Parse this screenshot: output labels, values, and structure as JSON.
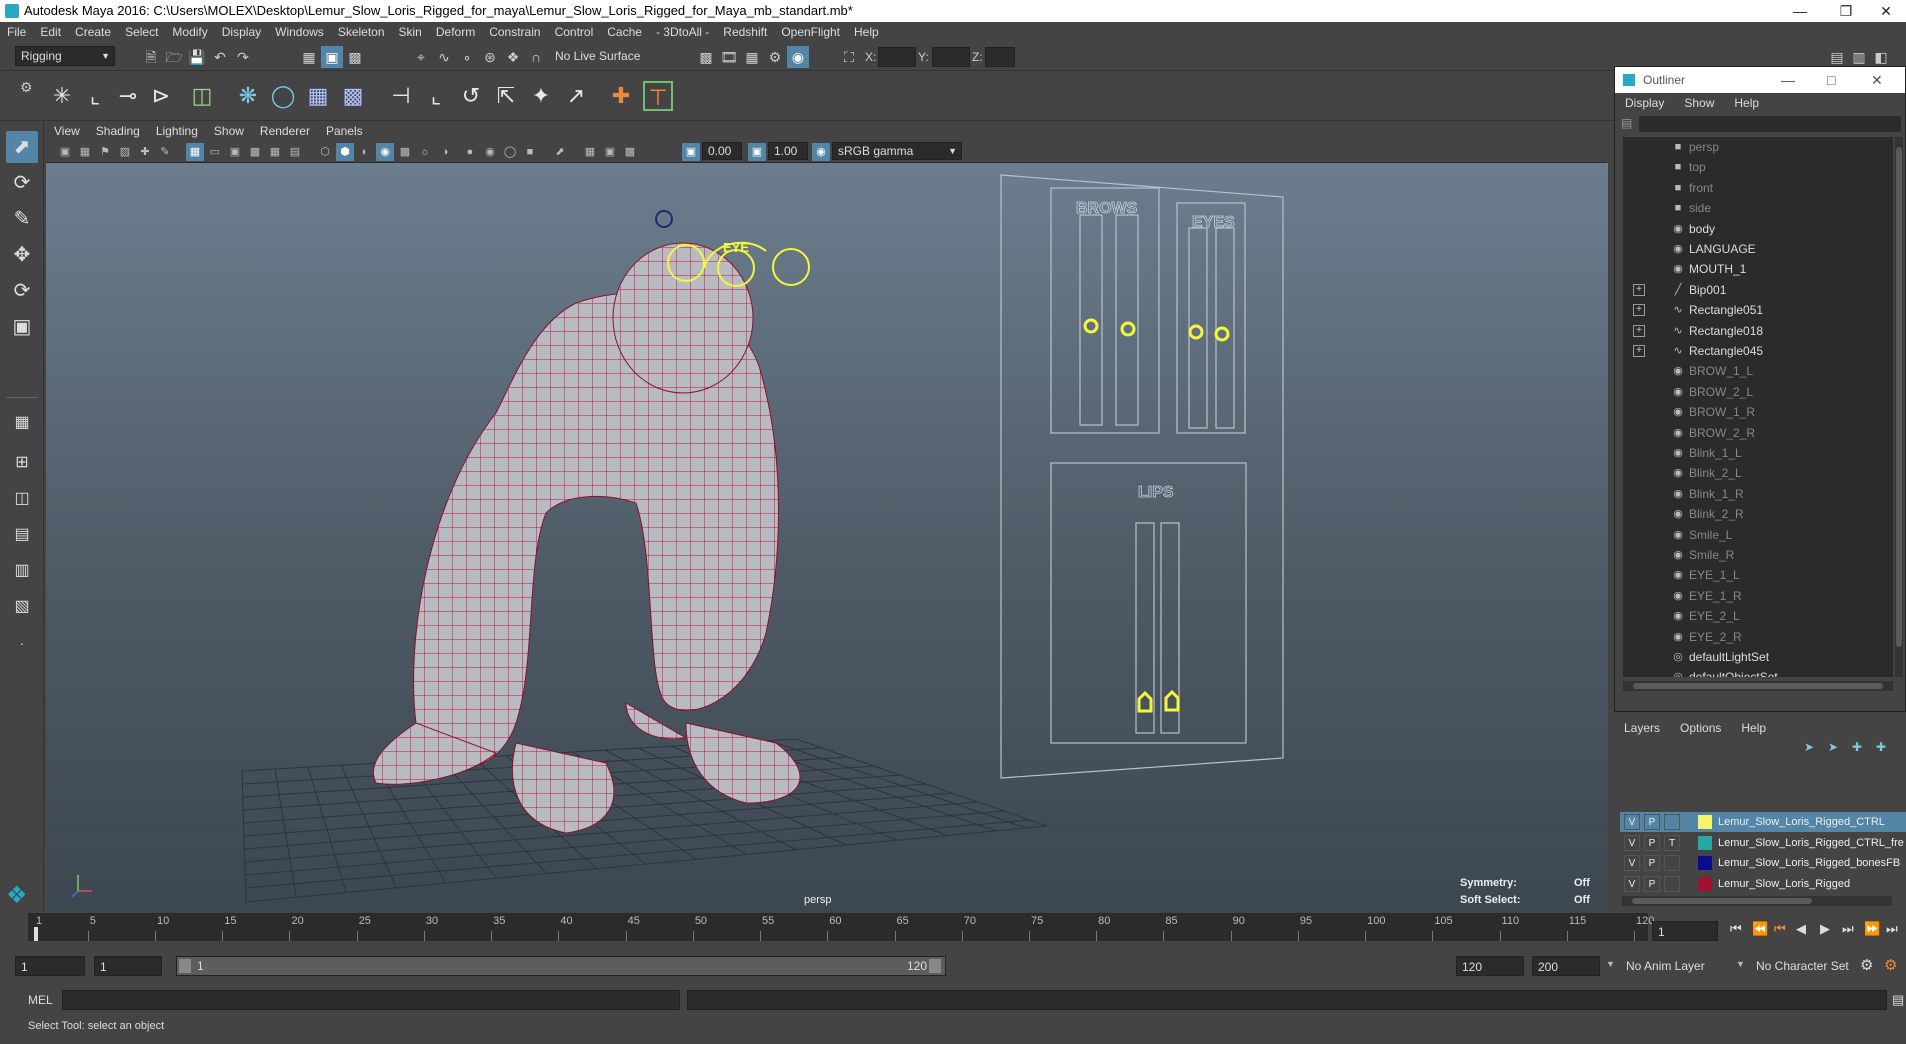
{
  "window": {
    "title": "Autodesk Maya 2016: C:\\Users\\MOLEX\\Desktop\\Lemur_Slow_Loris_Rigged_for_maya\\Lemur_Slow_Loris_Rigged_for_Maya_mb_standart.mb*"
  },
  "menubar": [
    "File",
    "Edit",
    "Create",
    "Select",
    "Modify",
    "Display",
    "Windows",
    "Skeleton",
    "Skin",
    "Deform",
    "Constrain",
    "Control",
    "Cache",
    "- 3DtoAll -",
    "Redshift",
    "OpenFlight",
    "Help"
  ],
  "statusline": {
    "mode": "Rigging",
    "live_surface": "No Live Surface",
    "x_label": "X:",
    "y_label": "Y:",
    "z_label": "Z:"
  },
  "viewport": {
    "menu": [
      "View",
      "Shading",
      "Lighting",
      "Show",
      "Renderer",
      "Panels"
    ],
    "near_value": "0.00",
    "far_value": "1.00",
    "color_space": "sRGB gamma",
    "camera_label": "persp",
    "symmetry_label": "Symmetry:",
    "symmetry_value": "Off",
    "soft_select_label": "Soft Select:",
    "soft_select_value": "Off",
    "board_labels": {
      "brows": "BROWS",
      "eyes": "EYES",
      "lips": "LIPS",
      "eye_ctrl": "EYE"
    }
  },
  "outliner": {
    "title": "Outliner",
    "menu": [
      "Display",
      "Show",
      "Help"
    ],
    "items": [
      {
        "name": "persp",
        "icon": "camera-icon",
        "dim": true,
        "expand": false
      },
      {
        "name": "top",
        "icon": "camera-icon",
        "dim": true,
        "expand": false
      },
      {
        "name": "front",
        "icon": "camera-icon",
        "dim": true,
        "expand": false
      },
      {
        "name": "side",
        "icon": "camera-icon",
        "dim": true,
        "expand": false
      },
      {
        "name": "body",
        "icon": "mesh-icon",
        "dim": false,
        "expand": false
      },
      {
        "name": "LANGUAGE",
        "icon": "mesh-icon",
        "dim": false,
        "expand": false
      },
      {
        "name": "MOUTH_1",
        "icon": "mesh-icon",
        "dim": false,
        "expand": false
      },
      {
        "name": "Bip001",
        "icon": "joint-icon",
        "dim": false,
        "expand": true
      },
      {
        "name": "Rectangle051",
        "icon": "curve-icon",
        "dim": false,
        "expand": true
      },
      {
        "name": "Rectangle018",
        "icon": "curve-icon",
        "dim": false,
        "expand": true
      },
      {
        "name": "Rectangle045",
        "icon": "curve-icon",
        "dim": false,
        "expand": true
      },
      {
        "name": "BROW_1_L",
        "icon": "mesh-icon",
        "dim": true,
        "expand": false
      },
      {
        "name": "BROW_2_L",
        "icon": "mesh-icon",
        "dim": true,
        "expand": false
      },
      {
        "name": "BROW_1_R",
        "icon": "mesh-icon",
        "dim": true,
        "expand": false
      },
      {
        "name": "BROW_2_R",
        "icon": "mesh-icon",
        "dim": true,
        "expand": false
      },
      {
        "name": "Blink_1_L",
        "icon": "mesh-icon",
        "dim": true,
        "expand": false
      },
      {
        "name": "Blink_2_L",
        "icon": "mesh-icon",
        "dim": true,
        "expand": false
      },
      {
        "name": "Blink_1_R",
        "icon": "mesh-icon",
        "dim": true,
        "expand": false
      },
      {
        "name": "Blink_2_R",
        "icon": "mesh-icon",
        "dim": true,
        "expand": false
      },
      {
        "name": "Smile_L",
        "icon": "mesh-icon",
        "dim": true,
        "expand": false
      },
      {
        "name": "Smile_R",
        "icon": "mesh-icon",
        "dim": true,
        "expand": false
      },
      {
        "name": "EYE_1_L",
        "icon": "mesh-icon",
        "dim": true,
        "expand": false
      },
      {
        "name": "EYE_1_R",
        "icon": "mesh-icon",
        "dim": true,
        "expand": false
      },
      {
        "name": "EYE_2_L",
        "icon": "mesh-icon",
        "dim": true,
        "expand": false
      },
      {
        "name": "EYE_2_R",
        "icon": "mesh-icon",
        "dim": true,
        "expand": false
      },
      {
        "name": "defaultLightSet",
        "icon": "set-icon",
        "dim": false,
        "expand": false
      },
      {
        "name": "defaultObjectSet",
        "icon": "set-icon",
        "dim": false,
        "expand": false
      }
    ]
  },
  "layers": {
    "tabs": [
      "Layers",
      "Options",
      "Help"
    ],
    "rows": [
      {
        "v": "V",
        "p": "P",
        "t": "",
        "color": "#f5f56a",
        "name": "Lemur_Slow_Loris_Rigged_CTRL",
        "selected": true
      },
      {
        "v": "V",
        "p": "P",
        "t": "T",
        "color": "#2aa6a6",
        "name": "Lemur_Slow_Loris_Rigged_CTRL_fre",
        "selected": false
      },
      {
        "v": "V",
        "p": "P",
        "t": "",
        "color": "#0b0b8c",
        "name": "Lemur_Slow_Loris_Rigged_bonesFB",
        "selected": false
      },
      {
        "v": "V",
        "p": "P",
        "t": "",
        "color": "#a01030",
        "name": "Lemur_Slow_Loris_Rigged",
        "selected": false
      }
    ]
  },
  "timeline": {
    "ticks": [
      1,
      5,
      10,
      15,
      20,
      25,
      30,
      35,
      40,
      45,
      50,
      55,
      60,
      65,
      70,
      75,
      80,
      85,
      90,
      95,
      100,
      105,
      110,
      115,
      120
    ],
    "current_frame": "1",
    "start_frame": "1",
    "playback_start": "1",
    "range_left": "1",
    "range_right": "120",
    "playback_end": "120",
    "anim_end": "200",
    "anim_layer": "No Anim Layer",
    "character_set": "No Character Set"
  },
  "command": {
    "label": "MEL"
  },
  "help_line": "Select Tool: select an object",
  "colors": {
    "accent": "#5285a6",
    "wire": "#c0143c",
    "control": "#f5f53c"
  }
}
